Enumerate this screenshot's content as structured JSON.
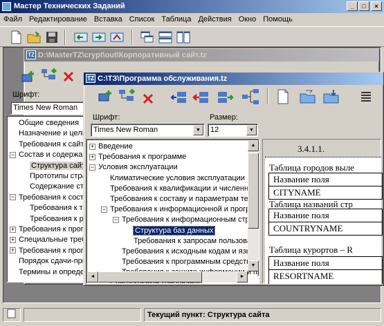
{
  "app": {
    "title": "Мастер Технических Заданий",
    "menu": [
      "Файл",
      "Редактирование",
      "Вставка",
      "Список",
      "Таблица",
      "Действия",
      "Окно",
      "Помощь"
    ],
    "status_text": "Текущий пункт: Структура сайта"
  },
  "back_window": {
    "title": "D:\\MasterTZ\\crypt\\out\\Корпоративный сайт.tz",
    "font_label": "Шрифт:",
    "font_value": "Times New Roman",
    "tree": [
      {
        "label": "Общие сведения",
        "level": 0,
        "exp": ""
      },
      {
        "label": "Назначение и цели",
        "level": 0,
        "exp": ""
      },
      {
        "label": "Требования к сайту",
        "level": 0,
        "exp": ""
      },
      {
        "label": "Состав и содержание",
        "level": 0,
        "exp": "-"
      },
      {
        "label": "Структура сайта",
        "level": 1,
        "exp": "",
        "selected": true
      },
      {
        "label": "Прототипы стра",
        "level": 1,
        "exp": ""
      },
      {
        "label": "Содержание стр",
        "level": 1,
        "exp": ""
      },
      {
        "label": "Требования к сост",
        "level": 0,
        "exp": "-"
      },
      {
        "label": "Требования к те",
        "level": 1,
        "exp": ""
      },
      {
        "label": "Требования к ра",
        "level": 1,
        "exp": ""
      },
      {
        "label": "Требования к прогр",
        "level": 0,
        "exp": "+"
      },
      {
        "label": "Специальные требов",
        "level": 0,
        "exp": "+"
      },
      {
        "label": "Требования к прогр",
        "level": 0,
        "exp": "+"
      },
      {
        "label": "Порядок сдачи-прие",
        "level": 0,
        "exp": ""
      },
      {
        "label": "Термины и определ",
        "level": 0,
        "exp": ""
      }
    ]
  },
  "front_window": {
    "title": "C:\\ТЗ\\Программа обслуживания.tz",
    "font_label": "Шрифт:",
    "font_value": "Times New Roman",
    "size_label": "Размер:",
    "size_value": "12",
    "tree": [
      {
        "label": "Введение",
        "level": 0,
        "exp": "+"
      },
      {
        "label": "Требования к программе",
        "level": 0,
        "exp": "+"
      },
      {
        "label": "Условия эксплуатации",
        "level": 0,
        "exp": "-"
      },
      {
        "label": "Климатические условия эксплуатации",
        "level": 1,
        "exp": ""
      },
      {
        "label": "Требования к квалификации и численности",
        "level": 1,
        "exp": ""
      },
      {
        "label": "Требования к составу и параметрам техниче",
        "level": 1,
        "exp": ""
      },
      {
        "label": "Требования к информационной и программн",
        "level": 1,
        "exp": "-"
      },
      {
        "label": "Требования к информационным структур",
        "level": 2,
        "exp": "-"
      },
      {
        "label": "Структура баз данных",
        "level": 3,
        "exp": "",
        "selected": true
      },
      {
        "label": "Требования к запросам пользовате",
        "level": 3,
        "exp": ""
      },
      {
        "label": "Требования к исходным кодам и языкам",
        "level": 2,
        "exp": ""
      },
      {
        "label": "Требования к программным средствам,",
        "level": 2,
        "exp": ""
      },
      {
        "label": "Требования к защите информации и прог",
        "level": 2,
        "exp": ""
      },
      {
        "label": "Специальные требования",
        "level": 1,
        "exp": ""
      }
    ],
    "doc": {
      "heading": "3.4.1.1.",
      "table1_caption": "Таблица городов выле",
      "table1_header": "Название поля",
      "table1_value": "CITYNAME",
      "table2_caption": "Таблица названий стр",
      "table2_header": "Название поля",
      "table2_value": "COUNTRYNAME",
      "table3_caption": "Таблица курортов – R",
      "table3_header": "Название поля",
      "table3_value": "RESORTNAME"
    }
  }
}
